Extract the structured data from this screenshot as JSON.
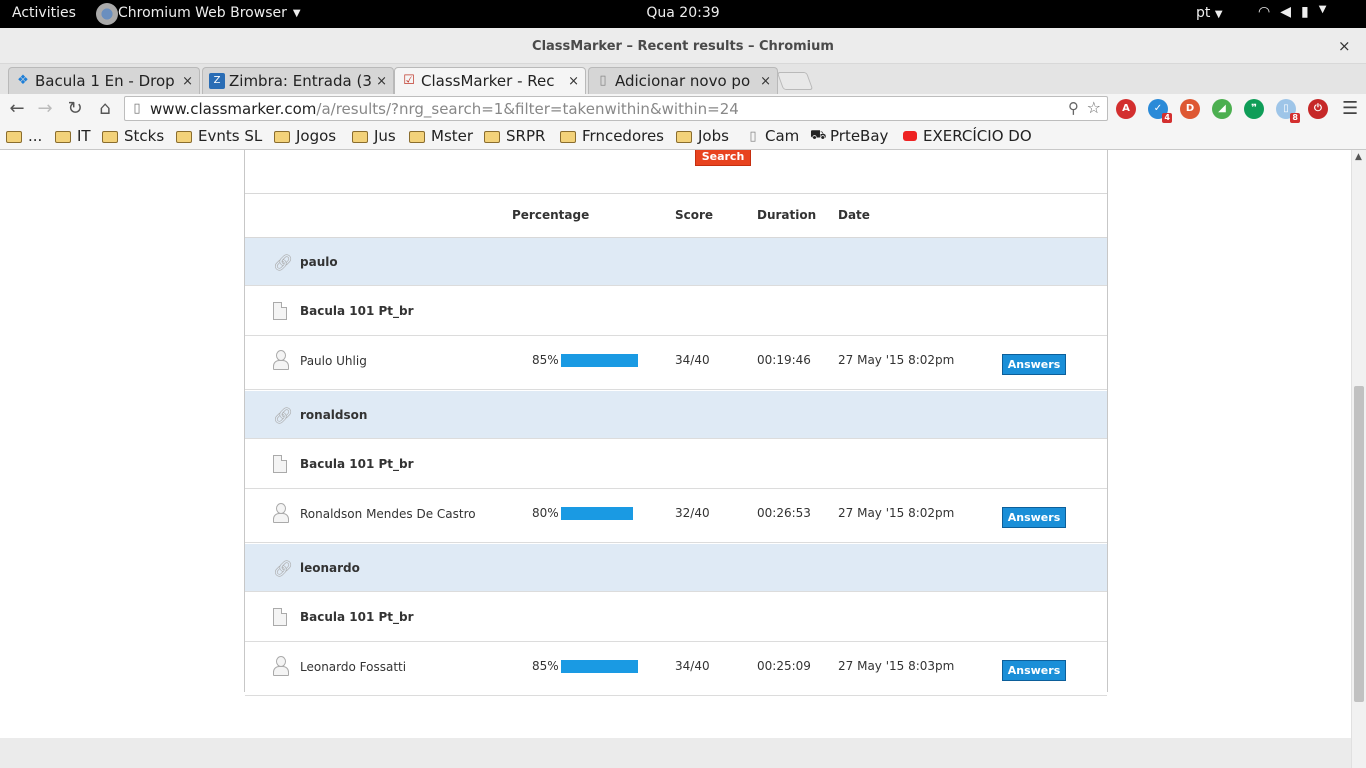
{
  "os_topbar": {
    "activities": "Activities",
    "app_name": "Chromium Web Browser",
    "clock": "Qua 20:39",
    "language": "pt"
  },
  "window": {
    "title": "ClassMarker – Recent results – Chromium",
    "close": "×"
  },
  "tabs": [
    {
      "label": "Bacula 1 En - Drop",
      "icon": "dropbox-icon"
    },
    {
      "label": "Zimbra: Entrada (3",
      "icon": "zimbra-icon"
    },
    {
      "label": "ClassMarker - Rec",
      "icon": "classmarker-icon",
      "active": true
    },
    {
      "label": "Adicionar novo po",
      "icon": "document-icon"
    }
  ],
  "tab_close": "×",
  "address_bar": {
    "url_host": "www.classmarker.com",
    "url_path": "/a/results/?nrg_search=1&filter=takenwithin&within=24"
  },
  "extensions": [
    {
      "icon": "adblock-icon",
      "color": "#d32f2f",
      "badge": ""
    },
    {
      "icon": "todo-icon",
      "color": "#2a8ad8",
      "badge": "4"
    },
    {
      "icon": "duckduckgo-icon",
      "color": "#de5833",
      "badge": ""
    },
    {
      "icon": "signal-icon",
      "color": "#4caf50",
      "badge": ""
    },
    {
      "icon": "hangouts-icon",
      "color": "#0f9d58",
      "badge": ""
    },
    {
      "icon": "docs-icon",
      "color": "#9ec5e8",
      "badge": "8"
    },
    {
      "icon": "power-icon",
      "color": "#c62828",
      "badge": ""
    }
  ],
  "bookmarks": [
    {
      "label": "...",
      "type": "folder"
    },
    {
      "label": "IT",
      "type": "folder"
    },
    {
      "label": "Stcks",
      "type": "folder"
    },
    {
      "label": "Evnts SL",
      "type": "folder"
    },
    {
      "label": "Jogos",
      "type": "folder"
    },
    {
      "label": "Jus",
      "type": "folder"
    },
    {
      "label": "Mster",
      "type": "folder"
    },
    {
      "label": "SRPR",
      "type": "folder"
    },
    {
      "label": "Frncedores",
      "type": "folder"
    },
    {
      "label": "Jobs",
      "type": "folder"
    },
    {
      "label": "Cam",
      "type": "page"
    },
    {
      "label": "PrteBay",
      "type": "pirate"
    },
    {
      "label": "EXERCÍCIO DO",
      "type": "youtube"
    }
  ],
  "page": {
    "search_button": "Search",
    "columns": {
      "percentage": "Percentage",
      "score": "Score",
      "duration": "Duration",
      "date": "Date"
    },
    "groups": [
      {
        "group": "paulo",
        "test": "Bacula 101 Pt_br",
        "person": "Paulo Uhlig",
        "percentage": "85%",
        "percentage_value": 85,
        "score": "34/40",
        "duration": "00:19:46",
        "date": "27 May '15 8:02pm",
        "answers": "Answers"
      },
      {
        "group": "ronaldson",
        "test": "Bacula 101 Pt_br",
        "person": "Ronaldson Mendes De Castro",
        "percentage": "80%",
        "percentage_value": 80,
        "score": "32/40",
        "duration": "00:26:53",
        "date": "27 May '15 8:02pm",
        "answers": "Answers"
      },
      {
        "group": "leonardo",
        "test": "Bacula 101 Pt_br",
        "person": "Leonardo Fossatti",
        "percentage": "85%",
        "percentage_value": 85,
        "score": "34/40",
        "duration": "00:25:09",
        "date": "27 May '15 8:03pm",
        "answers": "Answers"
      }
    ]
  }
}
